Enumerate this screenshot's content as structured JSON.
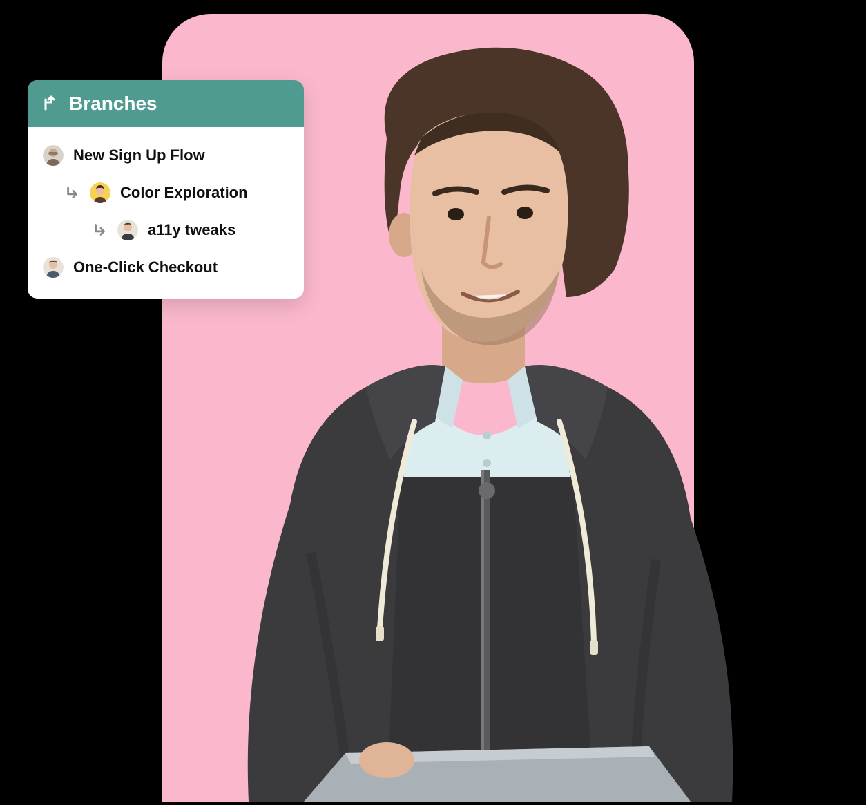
{
  "colors": {
    "backdrop": "#fbb8cd",
    "panel_header": "#4f9b8f",
    "panel_bg": "#ffffff",
    "text": "#111111"
  },
  "panel": {
    "title": "Branches",
    "icon": "branch-icon",
    "items": [
      {
        "label": "New Sign Up Flow",
        "indent": 0,
        "avatar": "avatar-1"
      },
      {
        "label": "Color Exploration",
        "indent": 1,
        "avatar": "avatar-2"
      },
      {
        "label": "a11y tweaks",
        "indent": 2,
        "avatar": "avatar-3"
      },
      {
        "label": "One-Click Checkout",
        "indent": 0,
        "avatar": "avatar-4"
      }
    ]
  }
}
